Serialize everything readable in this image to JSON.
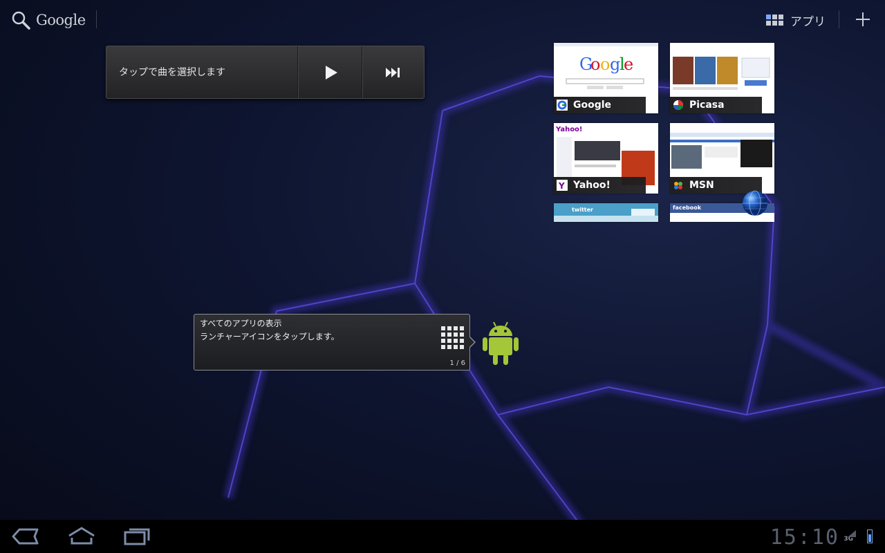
{
  "topbar": {
    "search_label": "Google",
    "apps_label": "アプリ"
  },
  "music_widget": {
    "title": "タップで曲を選択します"
  },
  "bookmarks": [
    {
      "name": "Google"
    },
    {
      "name": "Picasa"
    },
    {
      "name": "Yahoo!"
    },
    {
      "name": "MSN"
    }
  ],
  "partial_thumbnails": [
    {
      "visible_text": "twitter"
    },
    {
      "visible_text": "facebook"
    }
  ],
  "tooltip": {
    "line1": "すべてのアプリの表示",
    "line2": "ランチャーアイコンをタップします。",
    "page": "1 / 6"
  },
  "statusbar": {
    "clock": "15:10",
    "network": "3G"
  }
}
